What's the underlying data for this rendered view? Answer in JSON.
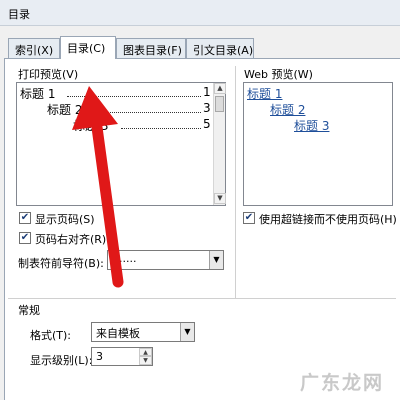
{
  "window": {
    "title": "目录"
  },
  "tabs": [
    {
      "label": "索引(X)"
    },
    {
      "label": "目录(C)"
    },
    {
      "label": "图表目录(F)"
    },
    {
      "label": "引文目录(A)"
    }
  ],
  "print_preview": {
    "label": "打印预览(V)",
    "entries": [
      {
        "text": "标题 1",
        "page": "1"
      },
      {
        "text": "标题 2",
        "page": "3"
      },
      {
        "text": "标题 3",
        "page": "5"
      }
    ]
  },
  "web_preview": {
    "label": "Web 预览(W)",
    "links": [
      "标题 1",
      "标题 2",
      "标题 3"
    ]
  },
  "options": {
    "show_page_numbers": {
      "label": "显示页码(S)",
      "checked": true
    },
    "right_align": {
      "label": "页码右对齐(R)",
      "checked": true
    },
    "hyperlinks": {
      "label": "使用超链接而不使用页码(H)",
      "checked": true
    },
    "tab_leader": {
      "label": "制表符前导符(B):",
      "value": "......."
    }
  },
  "general": {
    "heading": "常规",
    "format": {
      "label": "格式(T):",
      "value": "来自模板"
    },
    "levels": {
      "label": "显示级别(L):",
      "value": "3"
    }
  },
  "watermark": {
    "text": "广东龙网"
  },
  "icons": {
    "check": "✔",
    "dropdown": "▼",
    "up": "▲",
    "down": "▼"
  },
  "colors": {
    "arrow": "#e01818",
    "link": "#1f4f9a"
  }
}
